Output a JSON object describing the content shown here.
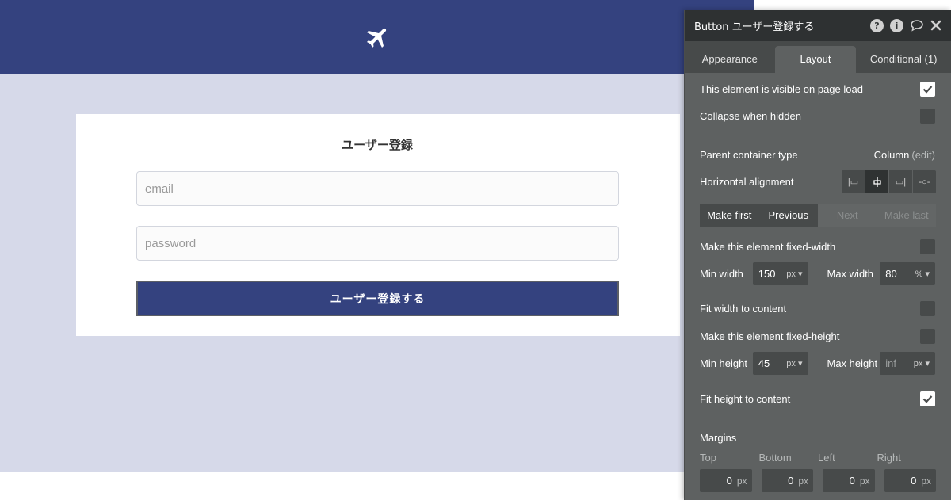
{
  "page": {
    "card_title": "ユーザー登録",
    "email_placeholder": "email",
    "password_placeholder": "password",
    "submit_label": "ユーザー登録する"
  },
  "panel": {
    "title": "Button ユーザー登録する",
    "head_icons": [
      "help-icon",
      "info-icon",
      "comment-icon",
      "close-icon"
    ],
    "tabs": [
      {
        "label": "Appearance"
      },
      {
        "label": "Layout"
      },
      {
        "label": "Conditional (1)"
      }
    ],
    "active_tab": "Layout",
    "visible_on_load": {
      "label": "This element is visible on page load",
      "checked": true
    },
    "collapse_hidden": {
      "label": "Collapse when hidden",
      "checked": false
    },
    "parent_container": {
      "label": "Parent container type",
      "value": "Column",
      "edit": "(edit)"
    },
    "horizontal_alignment": {
      "label": "Horizontal alignment",
      "options": [
        "align-left-icon",
        "align-center-icon",
        "align-right-icon",
        "align-distribute-icon"
      ],
      "selected": "align-center-icon"
    },
    "order_buttons": [
      {
        "label": "Make first",
        "enabled": true
      },
      {
        "label": "Previous",
        "enabled": true
      },
      {
        "label": "Next",
        "enabled": false
      },
      {
        "label": "Make last",
        "enabled": false
      }
    ],
    "fixed_width": {
      "label": "Make this element fixed-width",
      "checked": false
    },
    "min_width": {
      "label": "Min width",
      "value": "150",
      "unit": "px"
    },
    "max_width": {
      "label": "Max width",
      "value": "80",
      "unit": "%"
    },
    "fit_width": {
      "label": "Fit width to content",
      "checked": false
    },
    "fixed_height": {
      "label": "Make this element fixed-height",
      "checked": false
    },
    "min_height": {
      "label": "Min height",
      "value": "45",
      "unit": "px"
    },
    "max_height": {
      "label": "Max height",
      "placeholder": "inf",
      "unit": "px"
    },
    "fit_height": {
      "label": "Fit height to content",
      "checked": true
    },
    "margins": {
      "title": "Margins",
      "top": {
        "label": "Top",
        "value": "0",
        "unit": "px"
      },
      "bottom": {
        "label": "Bottom",
        "value": "0",
        "unit": "px"
      },
      "left": {
        "label": "Left",
        "value": "0",
        "unit": "px"
      },
      "right": {
        "label": "Right",
        "value": "0",
        "unit": "px"
      }
    }
  },
  "colors": {
    "brand_navy": "#34427f",
    "page_background": "#d6d9e9",
    "panel_background": "#5e6161",
    "panel_header": "#2e3132"
  }
}
